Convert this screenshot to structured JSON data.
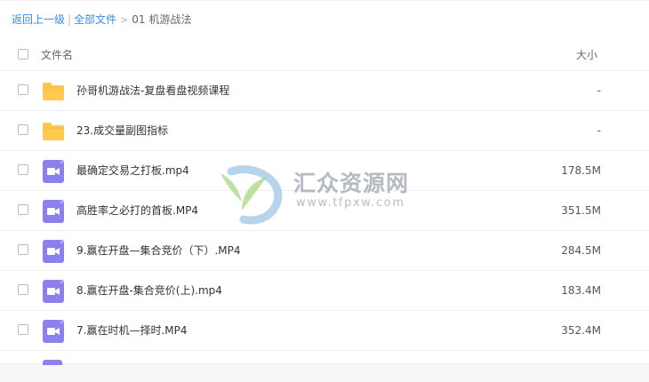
{
  "breadcrumb": {
    "back": "返回上一级",
    "all_files": "全部文件",
    "current": "01 机游战法"
  },
  "header": {
    "name_label": "文件名",
    "size_label": "大小"
  },
  "files": [
    {
      "name": "孙哥机游战法-复盘看盘视频课程",
      "size": "-",
      "type": "folder-icon"
    },
    {
      "name": "23.成交量副图指标",
      "size": "-",
      "type": "folder-icon"
    },
    {
      "name": "最确定交易之打板.mp4",
      "size": "178.5M",
      "type": "video-file-icon"
    },
    {
      "name": "高胜率之必打的首板.MP4",
      "size": "351.5M",
      "type": "video-file-icon"
    },
    {
      "name": "9.赢在开盘—集合竞价（下）.MP4",
      "size": "284.5M",
      "type": "video-file-icon"
    },
    {
      "name": "8.赢在开盘-集合竞价(上).mp4",
      "size": "183.4M",
      "type": "video-file-icon"
    },
    {
      "name": "7.赢在时机—择时.MP4",
      "size": "352.4M",
      "type": "video-file-icon"
    }
  ],
  "watermark": {
    "title": "汇众资源网",
    "url": "www.tfpxw.com"
  },
  "colors": {
    "link": "#3b8cde",
    "folder": "#ffc94d",
    "video": "#8b80ee"
  }
}
